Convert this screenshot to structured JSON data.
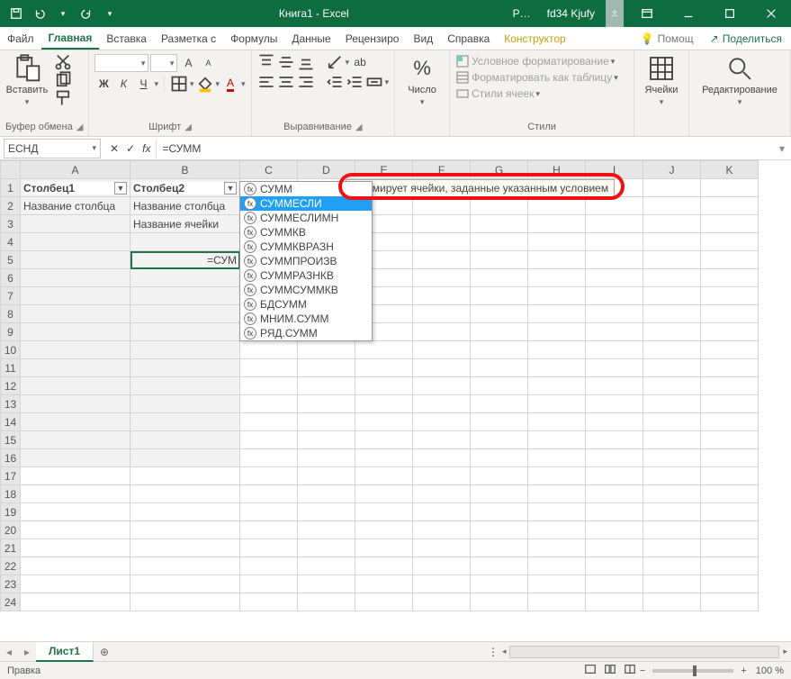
{
  "titlebar": {
    "title": "Книга1  -  Excel",
    "p_label": "P…",
    "username": "fd34 Kjufy"
  },
  "tabs": {
    "file": "Файл",
    "home": "Главная",
    "insert": "Вставка",
    "layout": "Разметка с",
    "formulas": "Формулы",
    "data": "Данные",
    "review": "Рецензиро",
    "view": "Вид",
    "help": "Справка",
    "konstruktor": "Конструктор",
    "tell": "Помощ",
    "share": "Поделиться"
  },
  "ribbon": {
    "clipboard": {
      "paste": "Вставить",
      "label": "Буфер обмена"
    },
    "font": {
      "label": "Шрифт",
      "bold": "Ж",
      "italic": "К",
      "underline": "Ч"
    },
    "align": {
      "label": "Выравнивание"
    },
    "number": {
      "big": "%",
      "label": "Число"
    },
    "styles": {
      "cond": "Условное форматирование",
      "table": "Форматировать как таблицу",
      "cell": "Стили ячеек",
      "label": "Стили"
    },
    "cells": {
      "big": "Ячейки"
    },
    "editing": {
      "big": "Редактирование"
    }
  },
  "namebox": "ЕСНД",
  "formula": "=СУММ",
  "columns": [
    "",
    "A",
    "B",
    "C",
    "D",
    "E",
    "F",
    "G",
    "H",
    "I",
    "J",
    "K"
  ],
  "rows": [
    "1",
    "2",
    "3",
    "4",
    "5",
    "6",
    "7",
    "8",
    "9",
    "10",
    "11",
    "12",
    "13",
    "14",
    "15",
    "16",
    "17",
    "18",
    "19",
    "20",
    "21",
    "22",
    "23",
    "24"
  ],
  "table": {
    "h1": "Столбец1",
    "h2": "Столбец2",
    "a2": "Название столбца",
    "b2": "Название столбца",
    "b3": "Название ячейки",
    "b5": "=СУМ"
  },
  "popup": {
    "items": [
      "СУММ",
      "СУММЕСЛИ",
      "СУММЕСЛИМН",
      "СУММКВ",
      "СУММКВРАЗН",
      "СУММПРОИЗВ",
      "СУММРАЗНКВ",
      "СУММСУММКВ",
      "БДСУММ",
      "МНИМ.СУММ",
      "РЯД.СУММ"
    ],
    "selected_index": 1
  },
  "tooltip": "Суммирует ячейки, заданные указанным условием",
  "sheet_tabs": {
    "sheet1": "Лист1"
  },
  "status": {
    "mode": "Правка",
    "zoom": "100 %",
    "minus": "−",
    "plus": "+"
  },
  "glyphs": {
    "caret_down": "▾",
    "caret_right": "▸",
    "caret_left": "◂",
    "cancel": "✕",
    "check": "✓",
    "fx_label": "fx",
    "lamp": "💡",
    "share_icon": "↗",
    "plus_circle": "⊕",
    "dots": "⋮",
    "filter": "▼",
    "ribopt": "▪",
    "x": "✕"
  }
}
